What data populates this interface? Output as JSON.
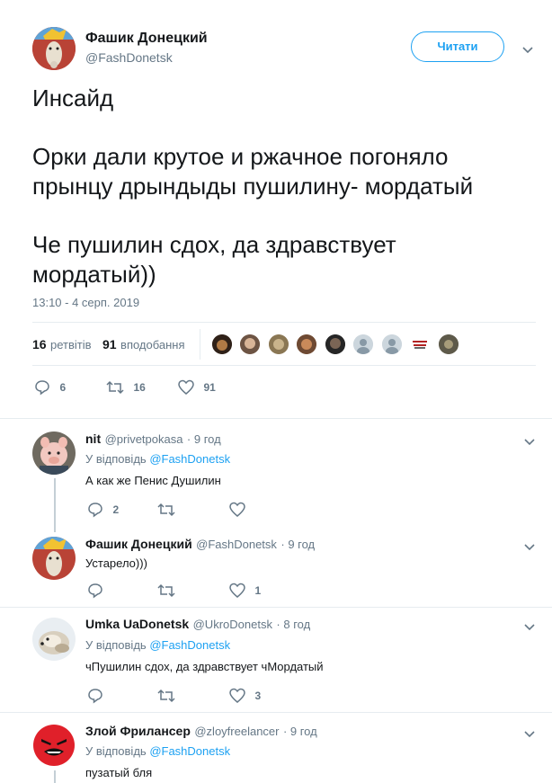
{
  "main_tweet": {
    "author_name": "Фашик Донецкий",
    "author_handle": "@FashDonetsk",
    "follow_label": "Читати",
    "text_line1": "Инсайд",
    "text_line2": "Орки дали крутое и ржачное погоняло",
    "text_line3": "прынцу дрындыды пушилину- мордатый",
    "text_line4": "Че пушилин сдох, да здравствует",
    "text_line5": "мордатый))",
    "timestamp": "13:10 - 4 серп. 2019",
    "retweets_count": "16",
    "retweets_label": "ретвітів",
    "likes_count": "91",
    "likes_label": "вподобання",
    "actions": {
      "replies": "6",
      "retweets": "16",
      "likes": "91"
    }
  },
  "replies": [
    {
      "author_name": "nit",
      "author_handle": "@privetpokasa",
      "time": "· 9 год",
      "reply_to_prefix": "У відповідь",
      "reply_to_handle": "@FashDonetsk",
      "text": "А как же Пенис Душилин",
      "replies": "2",
      "retweets": "",
      "likes": ""
    },
    {
      "author_name": "Фашик Донецкий",
      "author_handle": "@FashDonetsk",
      "time": "· 9 год",
      "text": "Устарело)))",
      "replies": "",
      "retweets": "",
      "likes": "1"
    },
    {
      "author_name": "Umka UaDonetsk",
      "author_handle": "@UkroDonetsk",
      "time": "· 8 год",
      "reply_to_prefix": "У відповідь",
      "reply_to_handle": "@FashDonetsk",
      "text": "чПушилин сдох, да здравствует чМордатый",
      "replies": "",
      "retweets": "",
      "likes": "3"
    },
    {
      "author_name": "Злой Фрилансер",
      "author_handle": "@zloyfreelancer",
      "time": "· 9 год",
      "reply_to_prefix": "У відповідь",
      "reply_to_handle": "@FashDonetsk",
      "text": "пузатый бля"
    }
  ],
  "colors": {
    "accent": "#1da1f2",
    "muted": "#657786",
    "text": "#14171a",
    "divider": "#e6ecf0"
  }
}
